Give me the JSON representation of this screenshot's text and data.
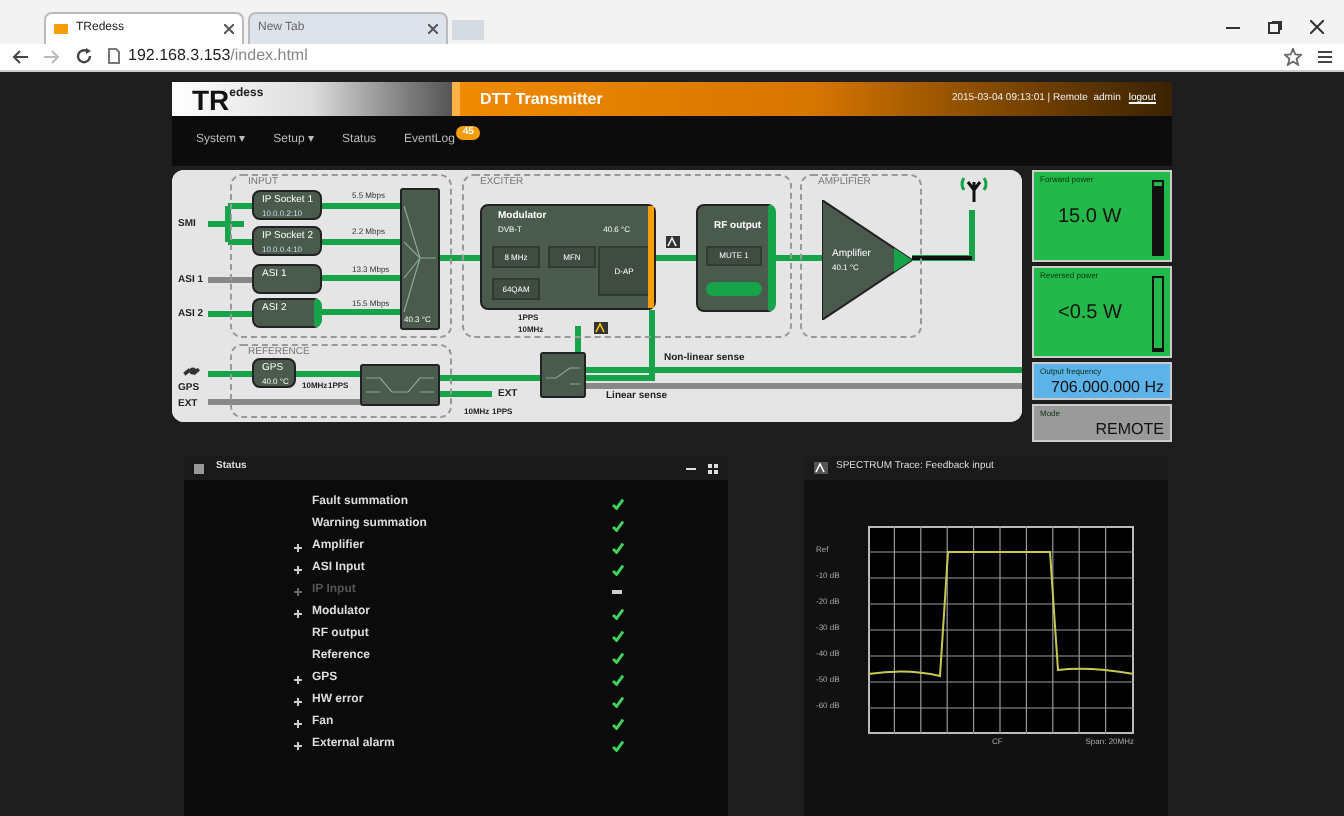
{
  "browser": {
    "tabs": [
      {
        "label": "TRedess",
        "selected": true
      },
      {
        "label": "New Tab",
        "selected": false
      }
    ],
    "url_host": "192.168.3.153",
    "url_path": "/index.html"
  },
  "header": {
    "logo_big": "TR",
    "logo_small": "edess",
    "title": "DTT Transmitter",
    "info": "2015-03-04 09:13:01 | Remote  admin",
    "logout": "logout"
  },
  "nav": [
    {
      "label": "System ▾"
    },
    {
      "label": "Setup ▾"
    },
    {
      "label": "Status"
    },
    {
      "label": "EventLog",
      "badge": "45"
    }
  ],
  "diagram": {
    "groups": [
      "INPUT",
      "EXCITER",
      "AMPLIFIER",
      "REFERENCE"
    ],
    "inputs": [
      "SMI",
      "ASI 1",
      "ASI 2",
      "GPS",
      "EXT"
    ],
    "input_blocks": [
      {
        "title": "IP Socket 1",
        "sub": "10.0.0.2:10",
        "rate": "5.5 Mbps"
      },
      {
        "title": "IP Socket 2",
        "sub": "10.0.0.4:10",
        "rate": "2.2 Mbps"
      },
      {
        "title": "ASI 1",
        "rate": "13.3 Mbps"
      },
      {
        "title": "ASI 2",
        "rate": "15.5 Mbps"
      }
    ],
    "switch_temp": "40.3 °C",
    "modulator": {
      "title": "Modulator",
      "standard": "DVB-T",
      "temp": "40.6 °C",
      "params": [
        "8 MHz",
        "MFN",
        "64QAM"
      ],
      "mode": "D-AP",
      "clock": [
        "1PPS",
        "10MHz"
      ]
    },
    "rf_output": {
      "title": "RF output",
      "state": "MUTE 1"
    },
    "amplifier": {
      "title": "Amplifier",
      "temp": "40.1 °C"
    },
    "gps": {
      "title": "GPS",
      "temp": "40.0 °C",
      "outputs": [
        "10MHz",
        "1PPS"
      ]
    },
    "ref_outputs": [
      "EXT",
      "10MHz",
      "1PPS"
    ],
    "senses": [
      "Non-linear sense",
      "Linear sense"
    ]
  },
  "widgets": [
    {
      "kind": "meter",
      "label": "Forward power",
      "value": "15.0 W",
      "level": 0.95
    },
    {
      "kind": "meter",
      "label": "Reversed power",
      "value": "<0.5 W",
      "level": 0.03
    },
    {
      "kind": "frequency",
      "label": "Output frequency",
      "value": "706.000.000 Hz"
    },
    {
      "kind": "mode",
      "label": "Mode",
      "value": "REMOTE"
    }
  ],
  "status_panel": {
    "title": "Status",
    "items": [
      {
        "label": "Fault summation",
        "expandable": false,
        "disabled": false
      },
      {
        "label": "Warning summation",
        "expandable": false,
        "disabled": false
      },
      {
        "label": "Amplifier",
        "expandable": true,
        "disabled": false
      },
      {
        "label": "ASI Input",
        "expandable": true,
        "disabled": false
      },
      {
        "label": "IP Input",
        "expandable": true,
        "disabled": true
      },
      {
        "label": "Modulator",
        "expandable": true,
        "disabled": false
      },
      {
        "label": "RF output",
        "expandable": false,
        "disabled": false
      },
      {
        "label": "Reference",
        "expandable": false,
        "disabled": false
      },
      {
        "label": "GPS",
        "expandable": true,
        "disabled": false
      },
      {
        "label": "HW error",
        "expandable": true,
        "disabled": false
      },
      {
        "label": "Fan",
        "expandable": true,
        "disabled": false
      },
      {
        "label": "External alarm",
        "expandable": true,
        "disabled": false
      }
    ]
  },
  "spectrum_panel": {
    "title": "SPECTRUM Trace: Feedback input",
    "y_labels": [
      "Ref",
      "-10 dB",
      "-20 dB",
      "-30 dB",
      "-40 dB",
      "-50 dB",
      "-60 dB"
    ],
    "center_label": "CF",
    "span_label": "Span: 20MHz"
  }
}
